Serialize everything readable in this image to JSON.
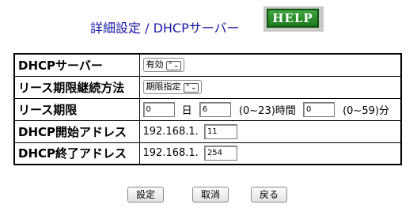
{
  "header": {
    "title": "詳細設定 / DHCPサーバー",
    "help_label": "HELP"
  },
  "rows": [
    {
      "label": "DHCPサーバー",
      "select_value": "有効"
    },
    {
      "label": "リース期限継続方法",
      "select_value": "期限指定"
    },
    {
      "label": "リース期限",
      "days_value": "0",
      "days_unit": "日",
      "hours_value": "6",
      "hours_unit": "(0~23)時間",
      "minutes_value": "0",
      "minutes_unit": "(0~59)分"
    },
    {
      "label": "DHCP開始アドレス",
      "prefix": "192.168.1.",
      "value": "11"
    },
    {
      "label": "DHCP終了アドレス",
      "prefix": "192.168.1.",
      "value": "254"
    }
  ],
  "buttons": {
    "save": "設定",
    "cancel": "取消",
    "back": "戻る"
  },
  "colors": {
    "title": "#1a1aa6",
    "help_button": "#2e8b2e"
  }
}
